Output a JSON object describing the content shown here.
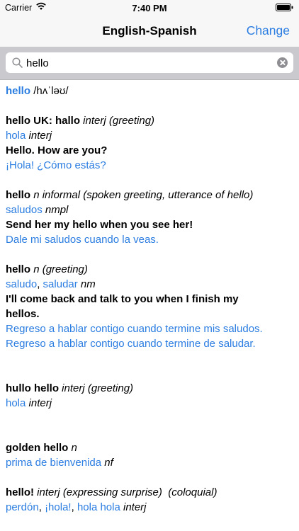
{
  "status": {
    "carrier": "Carrier",
    "time": "7:40 PM"
  },
  "nav": {
    "title": "English-Spanish",
    "change": "Change"
  },
  "search": {
    "value": "hello",
    "icon": "search-icon",
    "clear_icon": "clear-icon"
  },
  "entry0": {
    "word": "hello",
    "pron": "/hʌˈləʊ/"
  },
  "entry1": {
    "head": "hello UK: hallo",
    "pos": "interj (greeting)",
    "trans": "hola",
    "trans_pos": "interj",
    "ex_en": "Hello. How are you?",
    "ex_es": "¡Hola! ¿Cómo estás?"
  },
  "entry2": {
    "head": "hello",
    "pos": "n informal (spoken greeting, utterance of hello)",
    "trans": "saludos",
    "trans_pos": "nmpl",
    "ex_en": "Send her my hello when you see her!",
    "ex_es": "Dale mi saludos cuando la veas."
  },
  "entry3": {
    "head": "hello",
    "pos": "n (greeting)",
    "trans1": "saludo",
    "sep": ",",
    "trans2": "saludar",
    "trans_pos": "nm",
    "ex_en_1": "I'll come back and talk to you when I finish my",
    "ex_en_2": "hellos.",
    "ex_es_1": "Regreso a hablar contigo cuando termine mis saludos.",
    "ex_es_2": "Regreso a hablar contigo cuando termine de saludar."
  },
  "entry4": {
    "head": "hullo hello",
    "pos": "interj (greeting)",
    "trans": "hola",
    "trans_pos": "interj"
  },
  "entry5": {
    "head": "golden hello",
    "pos": "n",
    "trans": "prima de bienvenida",
    "trans_pos": "nf"
  },
  "entry6": {
    "head": "hello!",
    "pos": "interj (expressing surprise)",
    "register": "(coloquial)",
    "trans1": "perdón",
    "sep1": ",",
    "trans2": "¡hola!",
    "sep2": ",",
    "trans3": "hola hola",
    "trans_pos": "interj"
  },
  "colors": {
    "accent": "#2b7de1",
    "search_bg": "#c9c9ce",
    "bar_bg": "#f7f7f7"
  }
}
